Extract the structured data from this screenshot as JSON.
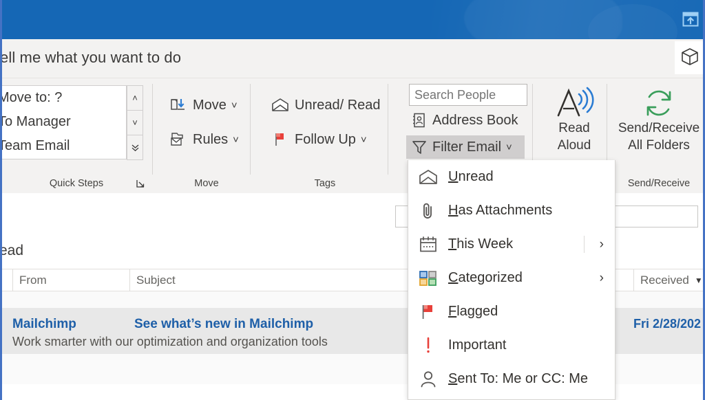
{
  "window": {
    "titlebar_color": "#1567b5",
    "ribbon_toggle_icon": "collapse-ribbon-icon",
    "addins_icon": "addins-box-icon"
  },
  "tellme": {
    "text": "ell me what you want to do"
  },
  "ribbon": {
    "groups": [
      {
        "name": "quick-steps",
        "label": "Quick Steps",
        "items": [
          {
            "label": "Move to: ?",
            "icon": "move-to-folder-icon"
          },
          {
            "label": "To Manager",
            "icon": "to-manager-icon"
          },
          {
            "label": "Team Email",
            "icon": "team-email-icon"
          }
        ],
        "scroll_up": "˄",
        "scroll_down": "˅",
        "scroll_more": "˅",
        "launcher": "dialog-launcher-icon"
      },
      {
        "name": "move",
        "label": "Move",
        "items": [
          {
            "label": "Move",
            "icon": "move-icon",
            "caret": "˅"
          },
          {
            "label": "Rules",
            "icon": "rules-icon",
            "caret": "˅"
          }
        ]
      },
      {
        "name": "tags",
        "label": "Tags",
        "items": [
          {
            "label": "Unread/ Read",
            "icon": "open-envelope-icon",
            "caret": ""
          },
          {
            "label": "Follow Up",
            "icon": "red-flag-icon",
            "caret": "˅"
          }
        ]
      },
      {
        "name": "find",
        "label": "",
        "search_placeholder": "Search People",
        "search_value": "",
        "items": [
          {
            "label": "Address Book",
            "icon": "address-book-icon",
            "active": false,
            "caret": ""
          },
          {
            "label": "Filter Email",
            "icon": "funnel-filter-icon",
            "active": true,
            "caret": "˅"
          }
        ]
      },
      {
        "name": "speech",
        "label": "",
        "button": {
          "icon": "read-aloud-icon",
          "line1": "Read",
          "line2": "Aloud"
        }
      },
      {
        "name": "send-receive",
        "label": "Send/Receive",
        "button": {
          "icon": "sync-refresh-icon",
          "line1": "Send/Receive",
          "line2": "All Folders"
        }
      }
    ]
  },
  "filter_menu": {
    "items": [
      {
        "label": "Unread",
        "accel": "U",
        "rest": "nread",
        "icon": "open-envelope-icon",
        "submenu": false
      },
      {
        "label": "Has Attachments",
        "accel": "H",
        "rest": "as Attachments",
        "icon": "paperclip-icon",
        "submenu": false
      },
      {
        "label": "This Week",
        "accel": "T",
        "rest": "his Week",
        "icon": "calendar-icon",
        "submenu": true
      },
      {
        "label": "Categorized",
        "accel": "C",
        "rest": "ategorized",
        "icon": "categories-squares-icon",
        "submenu": true
      },
      {
        "label": "Flagged",
        "accel": "F",
        "rest": "lagged",
        "icon": "red-flag-icon",
        "submenu": false
      },
      {
        "label": "Important",
        "accel": "I",
        "rest": "mportant",
        "icon": "exclamation-important-icon",
        "submenu": false
      },
      {
        "label": "Sent To: Me or CC: Me",
        "accel": "S",
        "rest": "ent To: Me or CC: Me",
        "icon": "person-icon",
        "submenu": false
      }
    ],
    "submenu_arrow": "›"
  },
  "mail_list": {
    "view_label": "read",
    "columns": [
      {
        "label": "",
        "name": "attachment-column"
      },
      {
        "label": "From",
        "name": "from-column"
      },
      {
        "label": "Subject",
        "name": "subject-column"
      },
      {
        "label": "Received",
        "name": "received-column",
        "sort_caret": "▼"
      }
    ],
    "rows": [
      {
        "from": "Mailchimp",
        "subject": "See what’s new in Mailchimp",
        "preview": "Work smarter with our optimization and organization tools",
        "received": "Fri 2/28/202"
      }
    ]
  },
  "colors": {
    "title_blue": "#1567b5",
    "link_blue": "#1e5fa8",
    "flag_red": "#e8403a",
    "sync_green": "#3a9e5b",
    "accent_blue": "#2b7cd3",
    "window_border": "#4472c4"
  }
}
